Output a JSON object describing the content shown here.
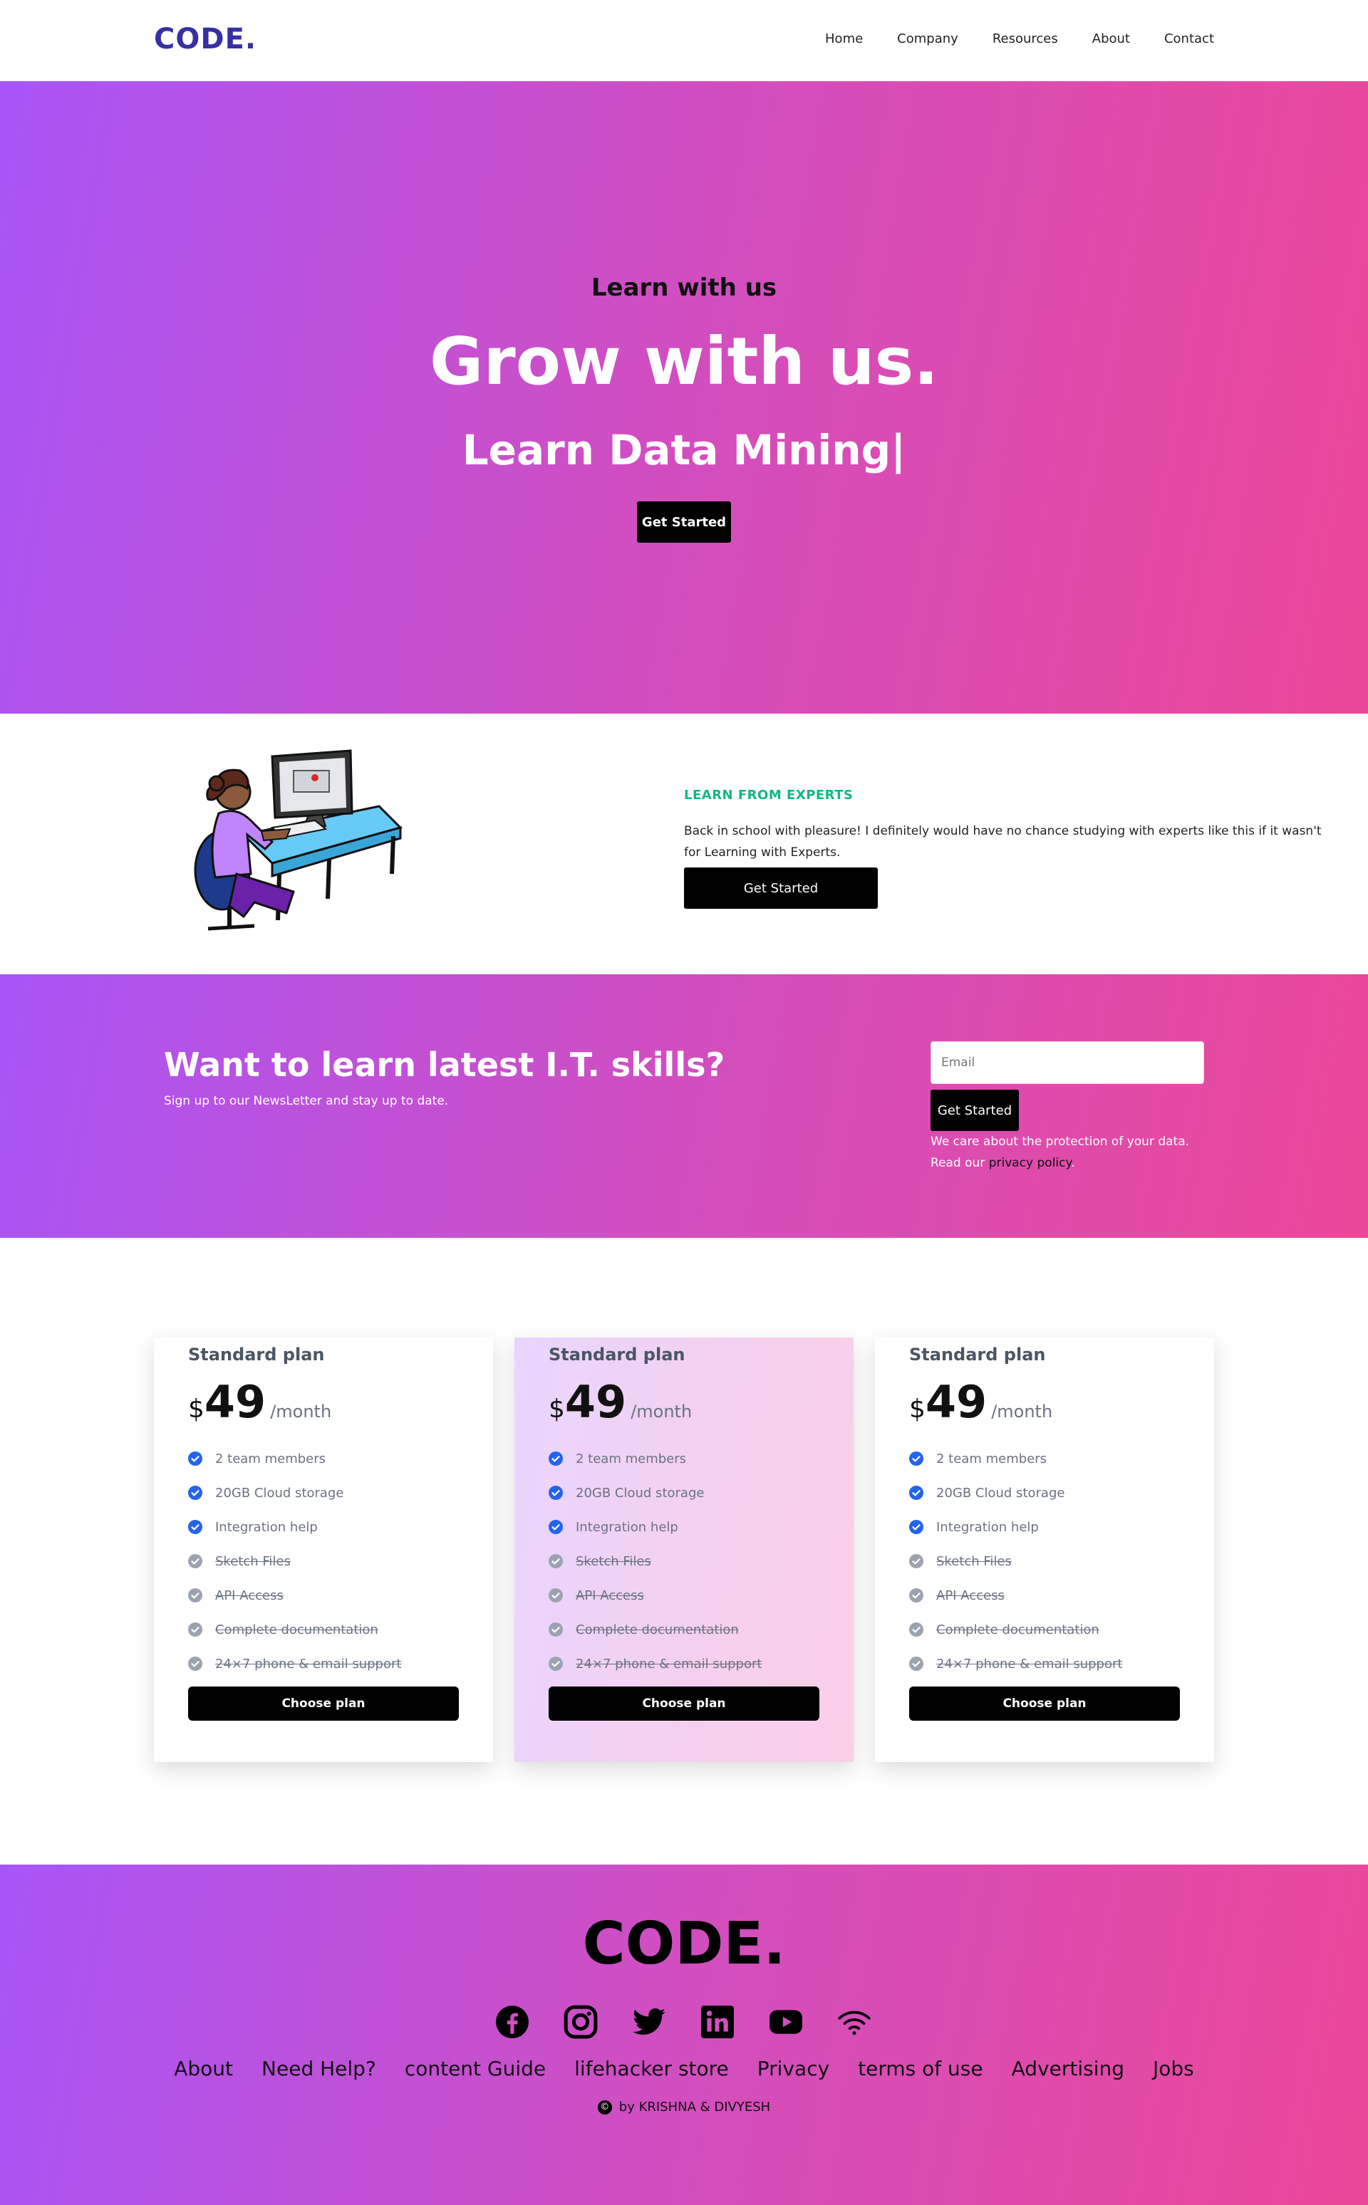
{
  "nav": {
    "logo": "CODE.",
    "links": [
      "Home",
      "Company",
      "Resources",
      "About",
      "Contact"
    ]
  },
  "hero": {
    "eyebrow": "Learn with us",
    "title": "Grow with us.",
    "subtitle": "Learn Data Mining|",
    "button": "Get Started"
  },
  "experts": {
    "eyebrow": "LEARN FROM EXPERTS",
    "text": "Back in school with pleasure! I definitely would have no chance studying with experts like this if it wasn't for Learning with Experts.",
    "button": "Get Started"
  },
  "newsletter": {
    "title": "Want to learn latest I.T. skills?",
    "subtitle": "Sign up to our NewsLetter and stay up to date.",
    "email_placeholder": "Email",
    "button": "Get Started",
    "note_line1": "We care about the protection of your data.",
    "note_line2_prefix": "Read our ",
    "note_link": "privacy policy",
    "note_suffix": "."
  },
  "pricing": {
    "plans": [
      {
        "title": "Standard plan",
        "currency": "$",
        "price": "49",
        "period": "/month",
        "button": "Choose plan",
        "features": [
          {
            "text": "2 team members",
            "included": true
          },
          {
            "text": "20GB Cloud storage",
            "included": true
          },
          {
            "text": "Integration help",
            "included": true
          },
          {
            "text": "Sketch Files",
            "included": false
          },
          {
            "text": "API Access",
            "included": false
          },
          {
            "text": "Complete documentation",
            "included": false
          },
          {
            "text": "24×7 phone & email support",
            "included": false
          }
        ]
      },
      {
        "title": "Standard plan",
        "currency": "$",
        "price": "49",
        "period": "/month",
        "button": "Choose plan",
        "features": [
          {
            "text": "2 team members",
            "included": true
          },
          {
            "text": "20GB Cloud storage",
            "included": true
          },
          {
            "text": "Integration help",
            "included": true
          },
          {
            "text": "Sketch Files",
            "included": false
          },
          {
            "text": "API Access",
            "included": false
          },
          {
            "text": "Complete documentation",
            "included": false
          },
          {
            "text": "24×7 phone & email support",
            "included": false
          }
        ]
      },
      {
        "title": "Standard plan",
        "currency": "$",
        "price": "49",
        "period": "/month",
        "button": "Choose plan",
        "features": [
          {
            "text": "2 team members",
            "included": true
          },
          {
            "text": "20GB Cloud storage",
            "included": true
          },
          {
            "text": "Integration help",
            "included": true
          },
          {
            "text": "Sketch Files",
            "included": false
          },
          {
            "text": "API Access",
            "included": false
          },
          {
            "text": "Complete documentation",
            "included": false
          },
          {
            "text": "24×7 phone & email support",
            "included": false
          }
        ]
      }
    ]
  },
  "footer": {
    "logo": "CODE.",
    "social_icons": [
      "facebook-icon",
      "instagram-icon",
      "twitter-icon",
      "linkedin-icon",
      "youtube-icon",
      "wifi-icon"
    ],
    "links": [
      "About",
      "Need Help?",
      "content Guide",
      "lifehacker store",
      "Privacy",
      "terms of use",
      "Advertising",
      "Jobs"
    ],
    "credit": "by KRISHNA & DIVYESH"
  },
  "colors": {
    "gradient_start": "#a855f7",
    "gradient_end": "#ec4899",
    "logo": "#3730a3",
    "experts_eyebrow": "#10b981",
    "check_included": "#2563eb",
    "check_excluded": "#9ca3af"
  }
}
